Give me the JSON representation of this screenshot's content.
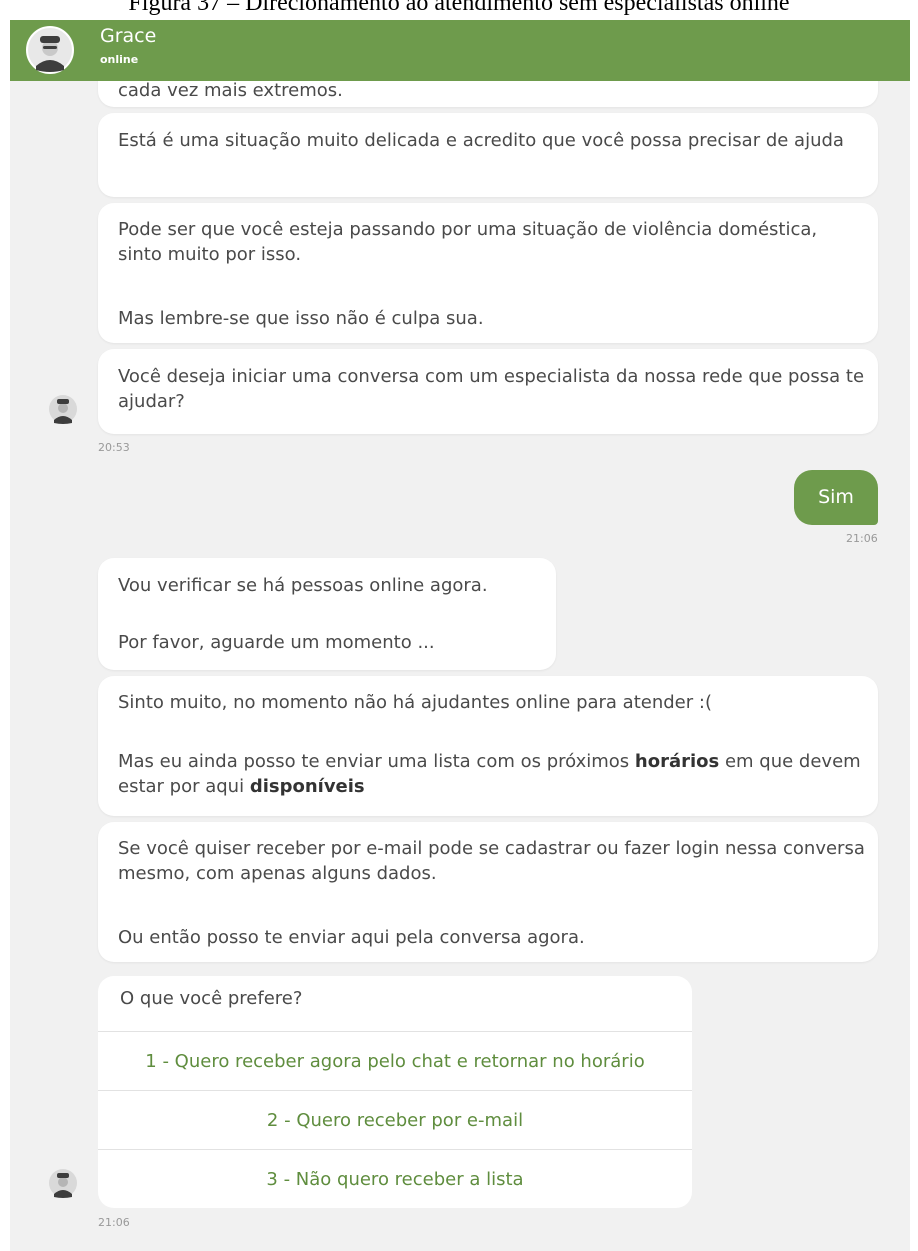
{
  "caption": "Figura 37 – Direcionamento ao atendimento sem especialistas online",
  "header": {
    "name": "Grace",
    "status": "online"
  },
  "messages": {
    "m0": "cada vez mais extremos.",
    "m1": "Está é uma situação muito delicada e acredito que você possa precisar de ajuda",
    "m2a": "Pode ser que você esteja passando por uma situação de violência doméstica, sinto muito por isso.",
    "m2b": "Mas lembre-se que isso não é culpa sua.",
    "m3": "Você deseja iniciar uma conversa com um especialista da nossa rede que possa te ajudar?",
    "t1": "20:53",
    "user_reply": "Sim",
    "t2": "21:06",
    "m4a": "Vou verificar se há pessoas online agora.",
    "m4b": "Por favor, aguarde um momento ...",
    "m5a": "Sinto muito, no momento não há ajudantes online para atender :(",
    "m5b_pre": "Mas eu ainda posso te enviar uma lista com os próximos ",
    "m5b_bold1": "horários",
    "m5b_mid": " em que devem estar por aqui ",
    "m5b_bold2": "disponíveis",
    "m6a": "Se você quiser receber por e-mail pode se cadastrar ou fazer login nessa conversa mesmo, com apenas alguns dados.",
    "m6b": "Ou então posso te enviar aqui pela conversa agora.",
    "question": "O que você prefere?",
    "options": [
      "1 - Quero receber agora pelo chat e retornar no horário",
      "2 - Quero receber por e-mail",
      "3 - Não quero receber a lista"
    ],
    "t3": "21:06"
  },
  "colors": {
    "brand": "#6e9b4c",
    "option_text": "#5f8d3e",
    "background": "#f1f1f1"
  },
  "icons": {
    "avatar": "bot-avatar-icon"
  }
}
